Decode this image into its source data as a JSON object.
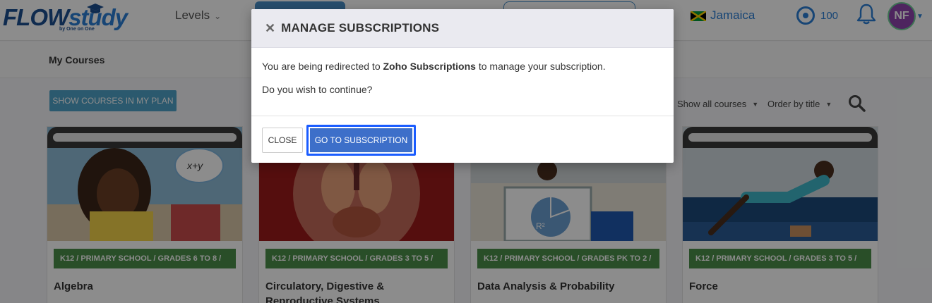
{
  "header": {
    "logo_main": "FLOW",
    "logo_accent": "study",
    "logo_sub": "by One on One",
    "levels_label": "Levels",
    "country": "Jamaica",
    "points": "100",
    "avatar_initials": "NF"
  },
  "subheader": {
    "title": "My Courses"
  },
  "toolbar": {
    "show_plan_label": "SHOW COURSES IN MY PLAN",
    "filter_label": "Show all courses",
    "order_label": "Order by title"
  },
  "courses": [
    {
      "tag": "K12 / PRIMARY SCHOOL / GRADES 6 TO 8 /",
      "title": "Algebra"
    },
    {
      "tag": "K12 / PRIMARY SCHOOL / GRADES 3 TO 5 /",
      "title": "Circulatory, Digestive & Reproductive Systems"
    },
    {
      "tag": "K12 / PRIMARY SCHOOL / GRADES PK TO 2 /",
      "title": "Data Analysis & Probability"
    },
    {
      "tag": "K12 / PRIMARY SCHOOL / GRADES 3 TO 5 /",
      "title": "Force"
    }
  ],
  "modal": {
    "title": "MANAGE SUBSCRIPTIONS",
    "line1_prefix": "You are being redirected to ",
    "line1_bold": "Zoho Subscriptions",
    "line1_suffix": " to manage your subscription.",
    "line2": "Do you wish to continue?",
    "close_label": "CLOSE",
    "go_label": "GO TO SUBSCRIPTION"
  },
  "colors": {
    "brand_blue": "#2b7fd6",
    "tag_green": "#4c8e4a",
    "primary_button": "#3d6fc9",
    "avatar_purple": "#8e44ad"
  },
  "icons": [
    "graduation-cap-icon",
    "chevron-down-icon",
    "jamaica-flag-icon",
    "target-icon",
    "bell-icon",
    "search-icon",
    "close-icon"
  ]
}
